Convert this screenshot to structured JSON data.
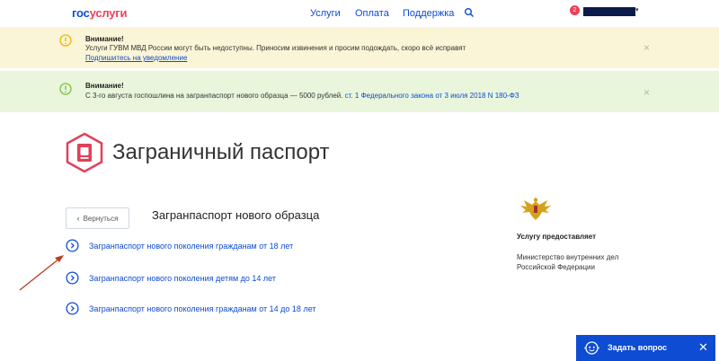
{
  "header": {
    "logo_part1": "гос",
    "logo_part2": "услуги",
    "nav": [
      "Услуги",
      "Оплата",
      "Поддержка"
    ],
    "search_icon": "search-icon",
    "notification_count": "2",
    "caret": "▾"
  },
  "alerts": [
    {
      "variant": "warning",
      "color": "#f0b400",
      "title": "Внимание!",
      "text": "Услуги ГУВМ МВД России могут быть недоступны. Приносим извинения и просим подождать, скоро всё исправят",
      "link": "Подпишитесь на уведомление",
      "close": "×"
    },
    {
      "variant": "success",
      "color": "#7cc043",
      "title": "Внимание!",
      "text": "С 3-го августа госпошлина на загранпаспорт нового образца — 5000 рублей.",
      "link": "ст. 1 Федерального закона от 3 июля 2018 N 180-ФЗ",
      "close": "×"
    }
  ],
  "page": {
    "title": "Заграничный паспорт",
    "icon": "passport-icon",
    "accent": "#e0405a"
  },
  "back": {
    "label": "Вернуться",
    "chevron": "‹"
  },
  "section_title": "Загранпаспорт нового образца",
  "services": [
    "Загранпаспорт нового поколения гражданам от 18 лет",
    "Загранпаспорт нового поколения детям до 14 лет",
    "Загранпаспорт нового поколения гражданам от 14 до 18 лет"
  ],
  "aside": {
    "title": "Услугу предоставляет",
    "org_line1": "Министерство внутренних дел",
    "org_line2": "Российской Федерации",
    "emblem": "eagle-emblem-icon"
  },
  "chat": {
    "label": "Задать вопрос",
    "close": "✕",
    "icon": "chat-bot-icon"
  },
  "colors": {
    "link": "#0d4cd3",
    "brand_red": "#ee3f58",
    "annotation_arrow": "#c0391f"
  }
}
